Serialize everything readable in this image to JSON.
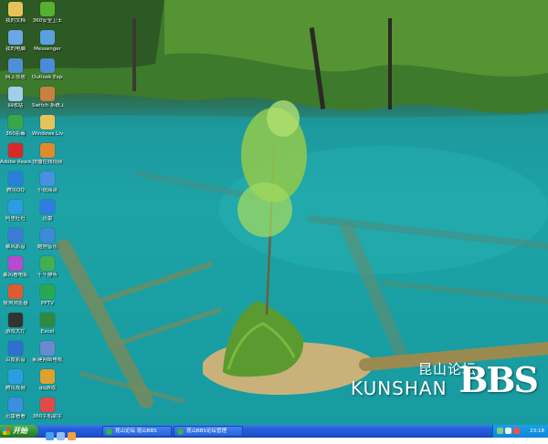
{
  "desktop": {
    "icons": [
      {
        "label": "我的文档",
        "icon": "folder-documents-icon",
        "color": "#e6c35a"
      },
      {
        "label": "我的电脑",
        "icon": "computer-icon",
        "color": "#6aa6e8"
      },
      {
        "label": "网上邻居",
        "icon": "network-icon",
        "color": "#4f8fd8"
      },
      {
        "label": "回收站",
        "icon": "recycle-bin-icon",
        "color": "#9fd0e8"
      },
      {
        "label": "360杀毒",
        "icon": "shield-icon",
        "color": "#3aa64a"
      },
      {
        "label": "Adobe Reader 9",
        "icon": "pdf-icon",
        "color": "#d62a2a"
      },
      {
        "label": "腾讯QQ",
        "icon": "qq-icon",
        "color": "#2a7fd8"
      },
      {
        "label": "阿里旺旺",
        "icon": "chat-icon",
        "color": "#2f9be0"
      },
      {
        "label": "暴风影音",
        "icon": "player-icon",
        "color": "#3d7ad6"
      },
      {
        "label": "暴风看电影",
        "icon": "movie-icon",
        "color": "#b84ad0"
      },
      {
        "label": "搜狗浏览器",
        "icon": "browser-icon",
        "color": "#e05a30"
      },
      {
        "label": "游戏大厅",
        "icon": "game-icon",
        "color": "#333333"
      },
      {
        "label": "百度影音",
        "icon": "media-icon",
        "color": "#2f6fd0"
      },
      {
        "label": "腾讯视频",
        "icon": "video-icon",
        "color": "#2a9fe0"
      },
      {
        "label": "迅雷看看",
        "icon": "thunder-icon",
        "color": "#3b8ee0"
      },
      {
        "label": "360安全卫士",
        "icon": "security-guard-icon",
        "color": "#58b030"
      },
      {
        "label": "Messenger",
        "icon": "messenger-icon",
        "color": "#5aa0e0"
      },
      {
        "label": "Outlook Express",
        "icon": "mail-icon",
        "color": "#4a8ad8"
      },
      {
        "label": "Switch 系统工具",
        "icon": "tool-icon",
        "color": "#c88040"
      },
      {
        "label": "Windows Live 照片",
        "icon": "photo-folder-icon",
        "color": "#e6c35a"
      },
      {
        "label": "快播在线视频",
        "icon": "quick-play-icon",
        "color": "#e08a30"
      },
      {
        "label": "小说阅读",
        "icon": "reader-icon",
        "color": "#4a90e0"
      },
      {
        "label": "迅雷",
        "icon": "download-icon",
        "color": "#2f7de0"
      },
      {
        "label": "酷狗音乐",
        "icon": "music-icon",
        "color": "#3c8ad8"
      },
      {
        "label": "千千静听",
        "icon": "listen-icon",
        "color": "#40b050"
      },
      {
        "label": "PPTV",
        "icon": "pptv-icon",
        "color": "#28a850"
      },
      {
        "label": "Excel",
        "icon": "excel-icon",
        "color": "#2f8a40"
      },
      {
        "label": "新建网络电视",
        "icon": "tv-icon",
        "color": "#6a8ad0"
      },
      {
        "label": "qq游戏",
        "icon": "qq-game-icon",
        "color": "#e0a030"
      },
      {
        "label": "360手机助手",
        "icon": "phone-assistant-icon",
        "color": "#e04a4a"
      }
    ]
  },
  "watermark": {
    "cn": "昆山论坛",
    "en": "KUNSHAN",
    "logo": "BBS"
  },
  "taskbar": {
    "start_label": "开始",
    "quick_launch": [
      {
        "icon": "ie-icon",
        "color": "#4aa0f0"
      },
      {
        "icon": "show-desktop-icon",
        "color": "#8fc0f0"
      },
      {
        "icon": "media-player-icon",
        "color": "#f0a040"
      }
    ],
    "tasks": [
      {
        "label": "昆山论坛 昆山BBS"
      },
      {
        "label": "昆山BBS论坛管理"
      }
    ],
    "tray_icons": [
      {
        "icon": "network-tray-icon",
        "color": "#7fd07f"
      },
      {
        "icon": "volume-icon",
        "color": "#f0f0f0"
      },
      {
        "icon": "antivirus-tray-icon",
        "color": "#f05050"
      }
    ],
    "clock": "23:18"
  }
}
